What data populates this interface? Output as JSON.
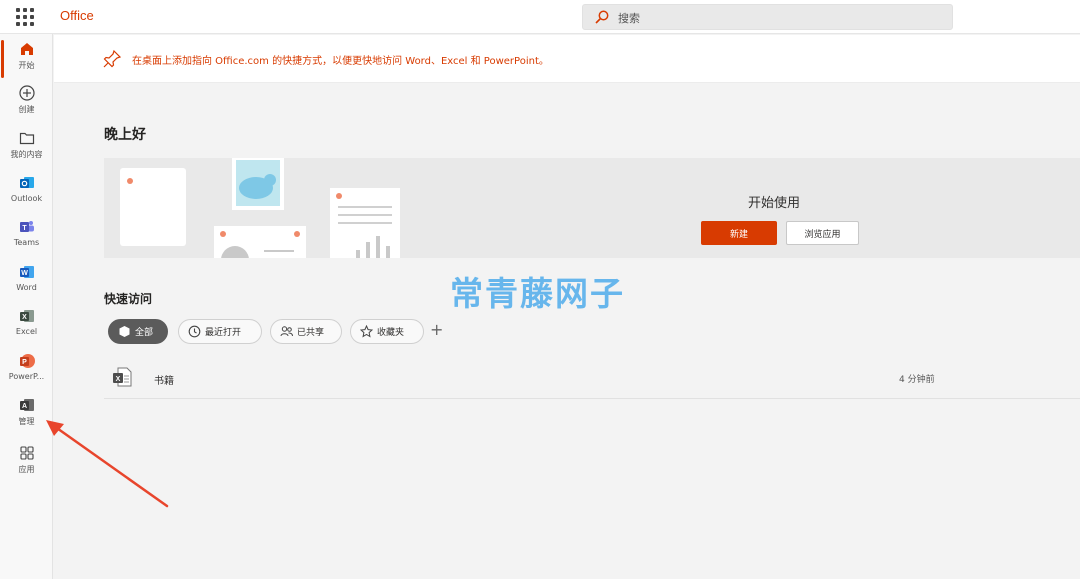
{
  "header": {
    "brand": "Office",
    "search_placeholder": "搜索"
  },
  "sidebar": {
    "items": [
      {
        "label": "开始",
        "icon": "home-icon",
        "active": true
      },
      {
        "label": "创建",
        "icon": "plus-circle-icon"
      },
      {
        "label": "我的内容",
        "icon": "folder-icon"
      },
      {
        "label": "Outlook",
        "icon": "outlook-icon"
      },
      {
        "label": "Teams",
        "icon": "teams-icon"
      },
      {
        "label": "Word",
        "icon": "word-icon"
      },
      {
        "label": "Excel",
        "icon": "excel-icon"
      },
      {
        "label": "PowerP...",
        "icon": "powerpoint-icon"
      },
      {
        "label": "管理",
        "icon": "admin-icon"
      },
      {
        "label": "应用",
        "icon": "apps-icon"
      }
    ]
  },
  "banner": {
    "text": "在桌面上添加指向 Office.com 的快捷方式，以便更快地访问 Word、Excel 和 PowerPoint。"
  },
  "main": {
    "greeting": "晚上好",
    "hero": {
      "title": "开始使用",
      "new_label": "新建",
      "browse_label": "浏览应用"
    },
    "watermark": "常青藤网子",
    "quick_access": {
      "title": "快速访问",
      "filters": [
        "全部",
        "最近打开",
        "已共享",
        "收藏夹"
      ],
      "add_label": "+"
    },
    "files": [
      {
        "name": "书籍",
        "time": "4 分钟前",
        "icon": "excel-file-icon"
      }
    ]
  },
  "colors": {
    "accent": "#d83b01",
    "watermark": "#67b6ec",
    "chip_active": "#5b5b5b"
  }
}
